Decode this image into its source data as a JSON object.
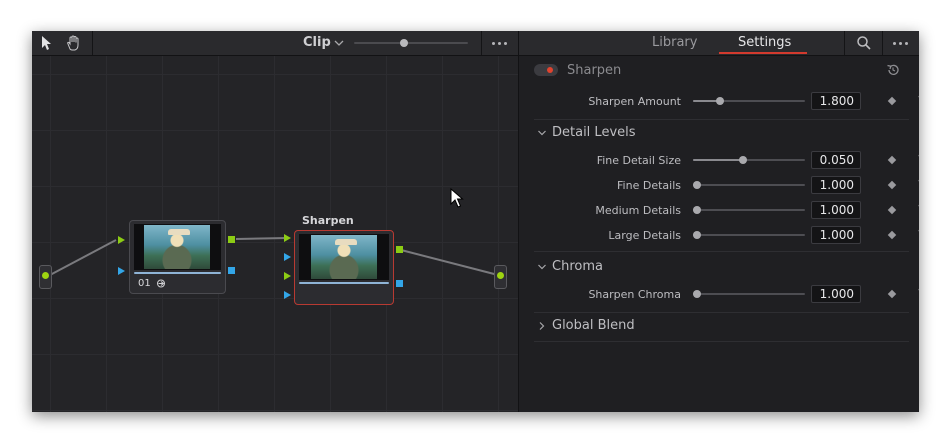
{
  "toolbar": {
    "clip_label": "Clip"
  },
  "nodes": {
    "node1_number": "01",
    "node2_label": "Sharpen"
  },
  "tabs": {
    "library": "Library",
    "settings": "Settings"
  },
  "plugin": {
    "name": "Sharpen",
    "enabled": true,
    "led_color": "#e0432f"
  },
  "params": {
    "sharpen_amount": {
      "label": "Sharpen Amount",
      "value": "1.800",
      "fraction": 0.22
    },
    "fine_detail_size": {
      "label": "Fine Detail Size",
      "value": "0.050",
      "fraction": 0.44
    },
    "fine_details": {
      "label": "Fine Details",
      "value": "1.000",
      "fraction": 0.0
    },
    "medium_details": {
      "label": "Medium Details",
      "value": "1.000",
      "fraction": 0.0
    },
    "large_details": {
      "label": "Large Details",
      "value": "1.000",
      "fraction": 0.0
    },
    "sharpen_chroma": {
      "label": "Sharpen Chroma",
      "value": "1.000",
      "fraction": 0.0
    }
  },
  "sections": {
    "detail_levels": "Detail Levels",
    "chroma": "Chroma",
    "global_blend": "Global Blend"
  },
  "colors": {
    "accent_red": "#d23a2e",
    "port_green": "#8ccc14",
    "port_blue": "#33a6e8"
  }
}
